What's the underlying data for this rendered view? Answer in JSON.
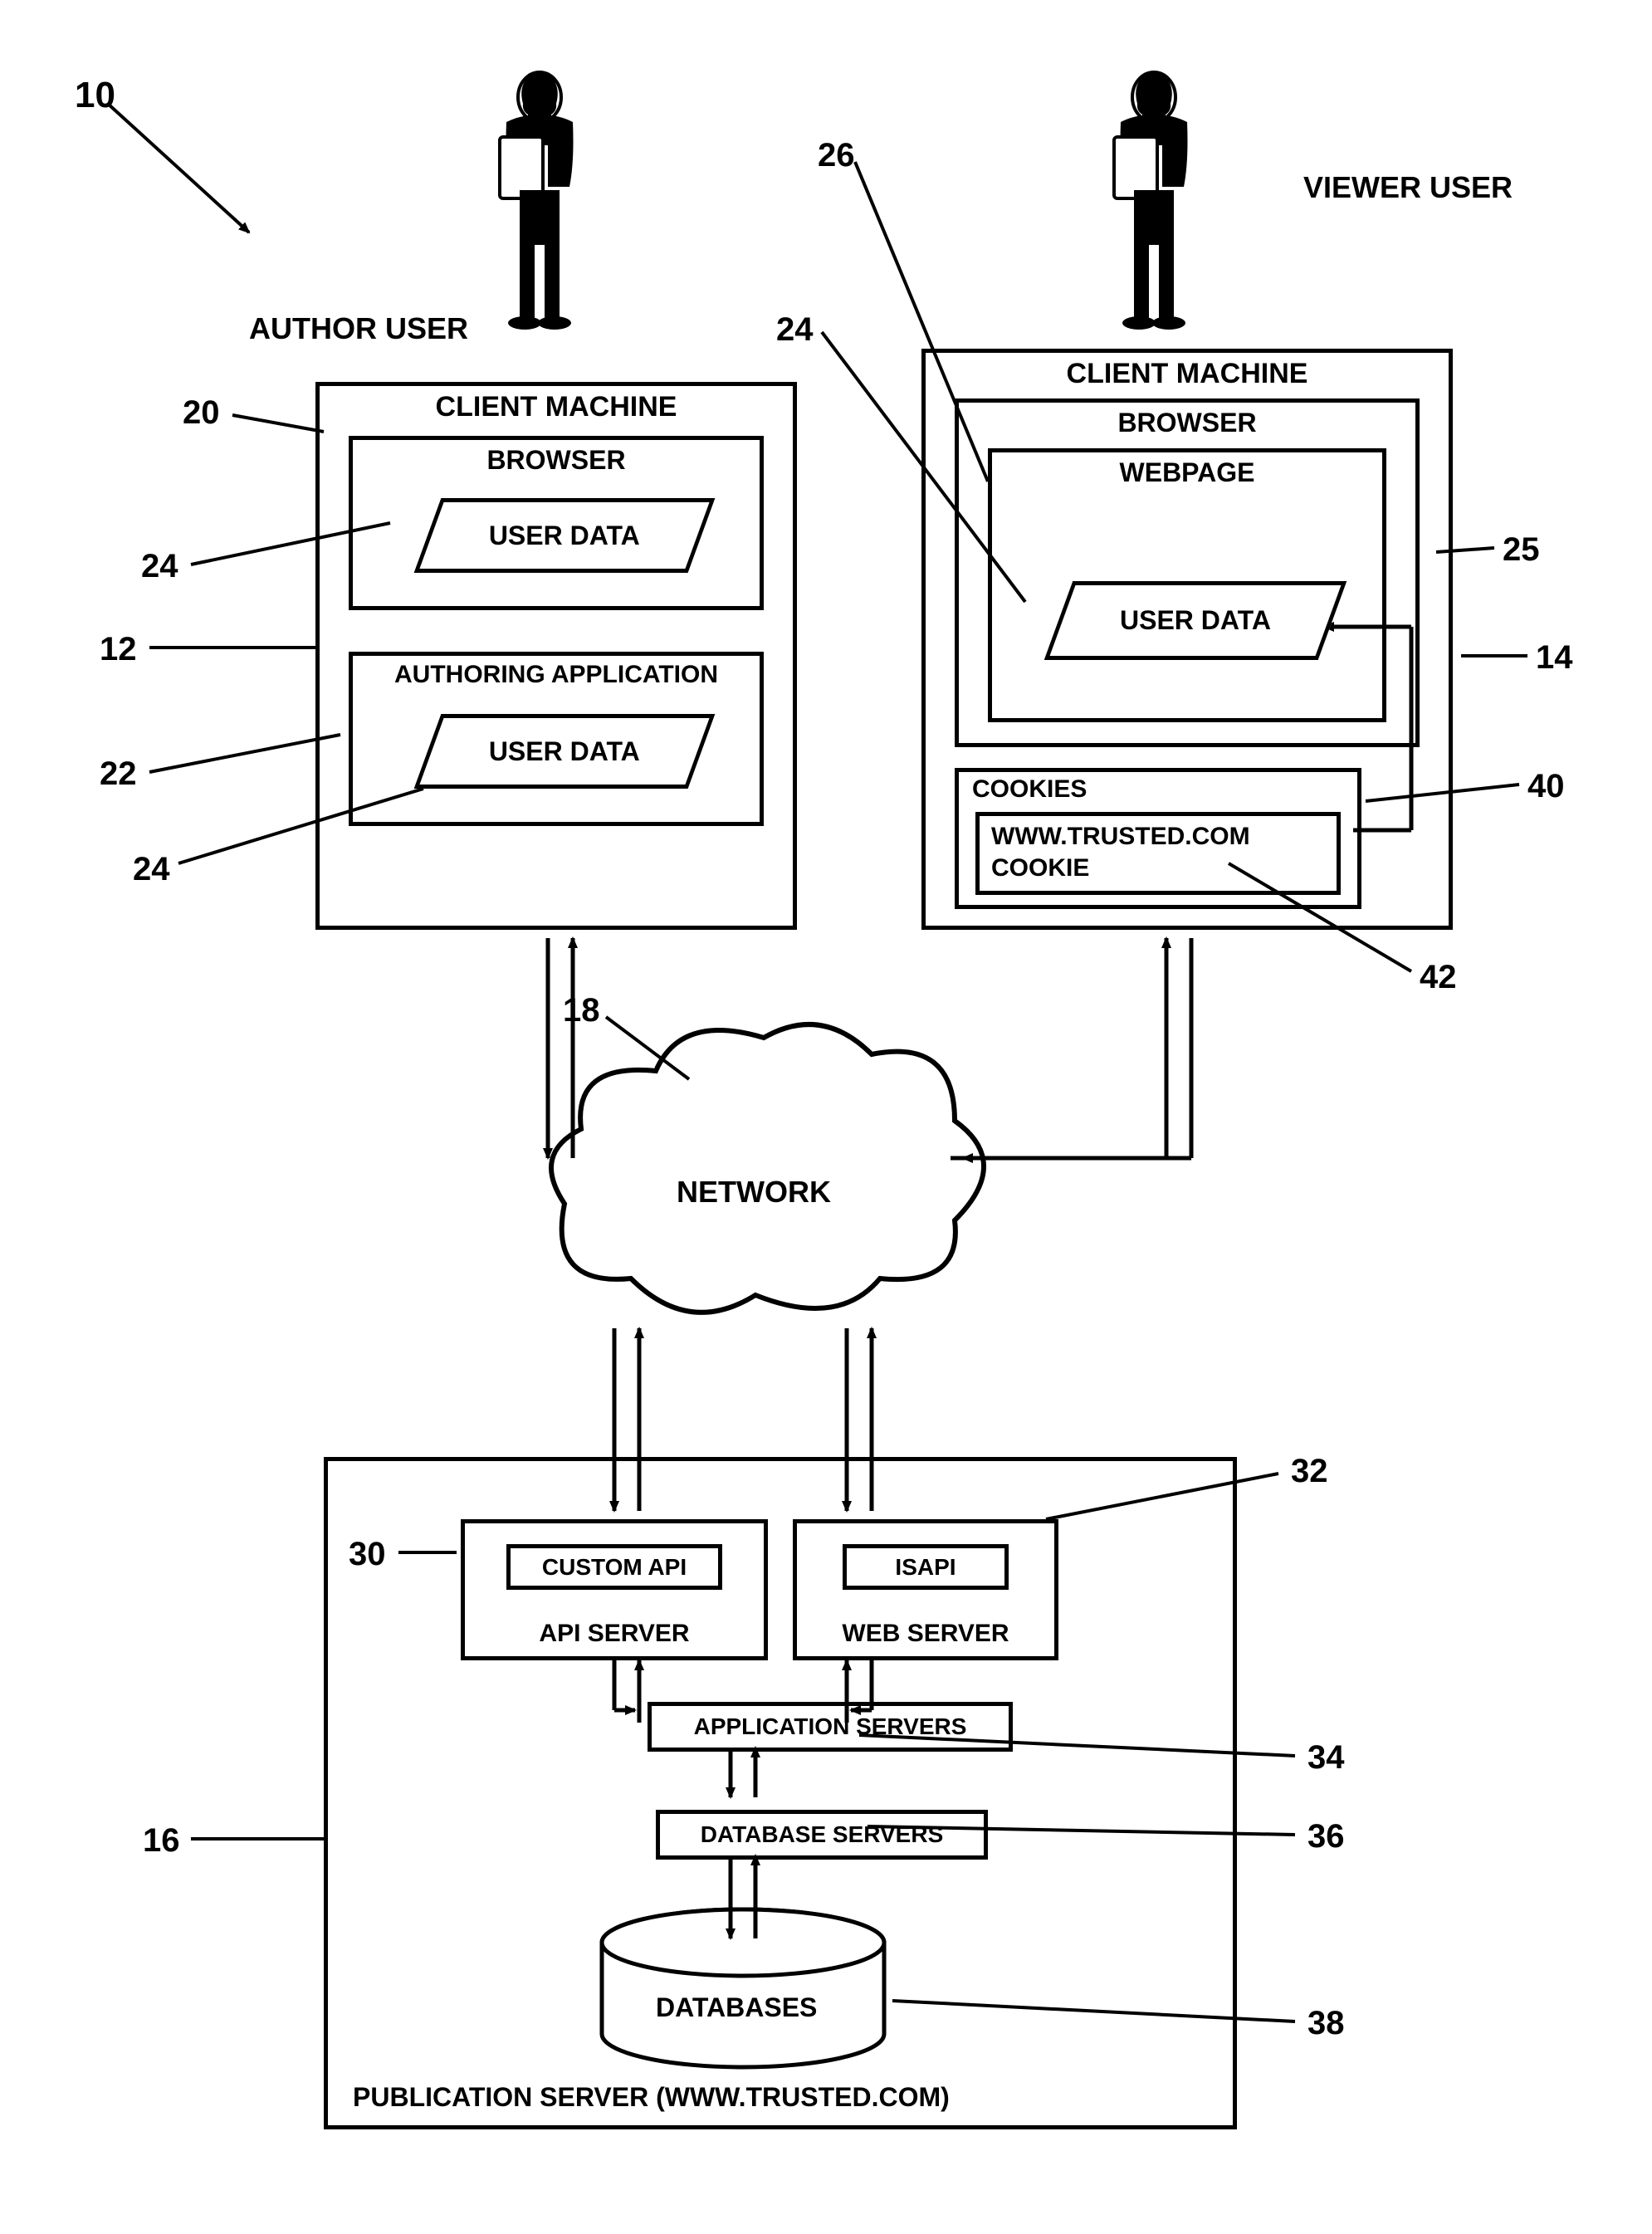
{
  "refs": {
    "r10": "10",
    "r12": "12",
    "r14": "14",
    "r16": "16",
    "r18": "18",
    "r20": "20",
    "r22": "22",
    "r24a": "24",
    "r24b": "24",
    "r24c": "24",
    "r25": "25",
    "r26": "26",
    "r30": "30",
    "r32": "32",
    "r34": "34",
    "r36": "36",
    "r38": "38",
    "r40": "40",
    "r42": "42"
  },
  "labels": {
    "author": "AUTHOR USER",
    "viewer": "VIEWER USER",
    "client_machine": "CLIENT MACHINE",
    "browser": "BROWSER",
    "webpage": "WEBPAGE",
    "user_data": "USER DATA",
    "authoring_app": "AUTHORING APPLICATION",
    "cookies": "COOKIES",
    "cookie_line1": "WWW.TRUSTED.COM",
    "cookie_line2": "COOKIE",
    "network": "NETWORK",
    "pub_server": "PUBLICATION SERVER  (WWW.TRUSTED.COM)",
    "api_server": "API  SERVER",
    "custom_api": "CUSTOM API",
    "web_server": "WEB SERVER",
    "isapi": "ISAPI",
    "app_servers": "APPLICATION SERVERS",
    "db_servers": "DATABASE SERVERS",
    "databases": "DATABASES"
  }
}
